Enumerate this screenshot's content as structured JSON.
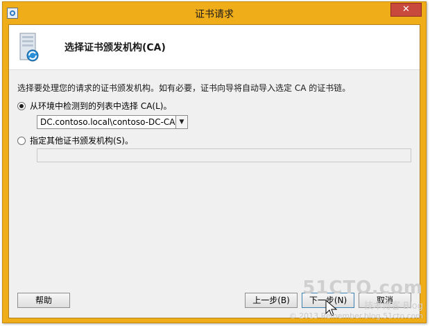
{
  "window": {
    "title": "证书请求",
    "close_glyph": "✕"
  },
  "header": {
    "title": "选择证书颁发机构(CA)"
  },
  "body": {
    "instruction": "选择要处理您的请求的证书颁发机构。如有必要，证书向导将自动导入选定 CA 的证书链。",
    "option_detected_label": "从环境中检测到的列表中选择 CA(L)。",
    "option_detected_checked": true,
    "ca_select_value": "DC.contoso.local\\contoso-DC-CA",
    "option_other_label": "指定其他证书颁发机构(S)。",
    "option_other_checked": false,
    "other_ca_value": ""
  },
  "footer": {
    "help_label": "帮助",
    "prev_label": "上一步(B)",
    "next_label": "下一步(N)",
    "cancel_label": "取消"
  },
  "watermark": {
    "site": "51CTO.com",
    "blog_text": "技术博客",
    "blog_en": "Blog",
    "copyright": "© 2013 Reinember.blog.51cto.com"
  },
  "colors": {
    "title_bar": "#f0ad1a",
    "close_button": "#c74a3c",
    "client_bg": "#f0f0f0"
  }
}
